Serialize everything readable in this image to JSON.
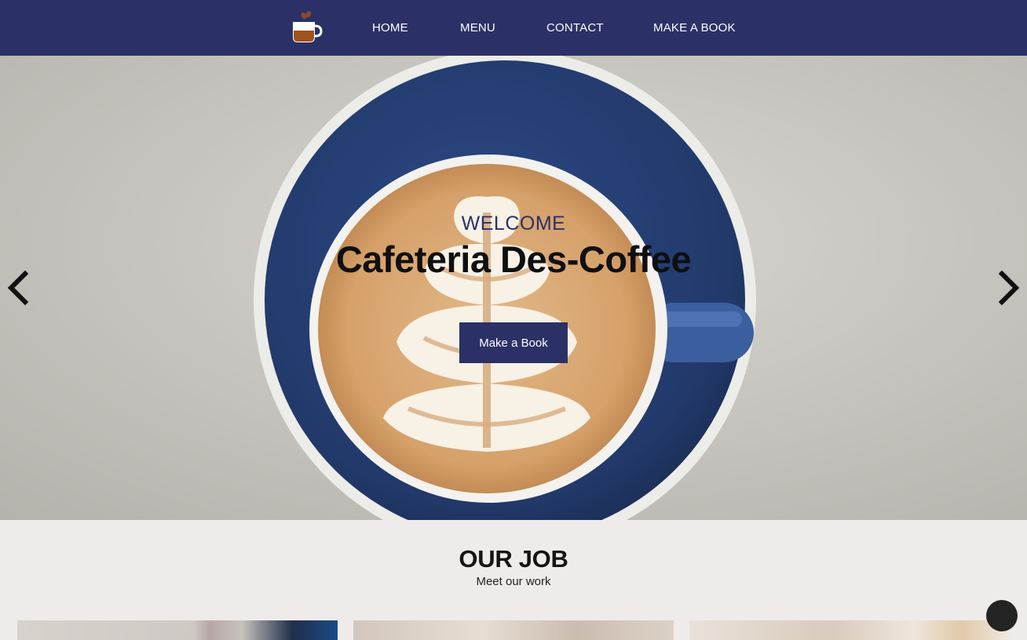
{
  "nav": {
    "logo": "coffee-cup-logo",
    "links": [
      "HOME",
      "MENU",
      "CONTACT",
      "MAKE A BOOK"
    ]
  },
  "hero": {
    "welcome": "WELCOME",
    "title": "Cafeteria Des-Coffee",
    "button": "Make a Book",
    "prev_icon": "chevron-left-icon",
    "next_icon": "chevron-right-icon"
  },
  "section": {
    "title": "OUR JOB",
    "subtitle": "Meet our work"
  },
  "colors": {
    "nav": "#2b3166",
    "button": "#2b3166",
    "section_bg": "#efebea"
  }
}
